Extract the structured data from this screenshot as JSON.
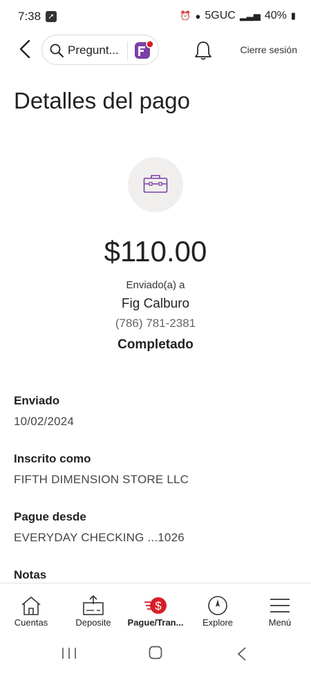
{
  "status_bar": {
    "time": "7:38",
    "network": "5GUC",
    "battery": "40%"
  },
  "header": {
    "search_placeholder": "Pregunt...",
    "logout_label": "Cierre sesión"
  },
  "page": {
    "title": "Detalles del pago"
  },
  "payment": {
    "amount": "$110.00",
    "sent_to_label": "Enviado(a) a",
    "payee_name": "Fig Calburo",
    "payee_phone": "(786) 781-2381",
    "status": "Completado"
  },
  "details": [
    {
      "label": "Enviado",
      "value": "10/02/2024"
    },
    {
      "label": "Inscrito como",
      "value": "FIFTH DIMENSION STORE LLC"
    },
    {
      "label": "Pague desde",
      "value": "EVERYDAY CHECKING ...1026"
    },
    {
      "label": "Notas",
      "value": ""
    }
  ],
  "bottom_nav": [
    {
      "label": "Cuentas",
      "icon": "house-icon"
    },
    {
      "label": "Deposite",
      "icon": "deposit-icon"
    },
    {
      "label": "Pague/Tran...",
      "icon": "pay-transfer-icon"
    },
    {
      "label": "Explore",
      "icon": "compass-icon"
    },
    {
      "label": "Menú",
      "icon": "menu-icon"
    }
  ],
  "colors": {
    "brand_purple": "#7b3fa6",
    "brand_red": "#d71e28"
  }
}
